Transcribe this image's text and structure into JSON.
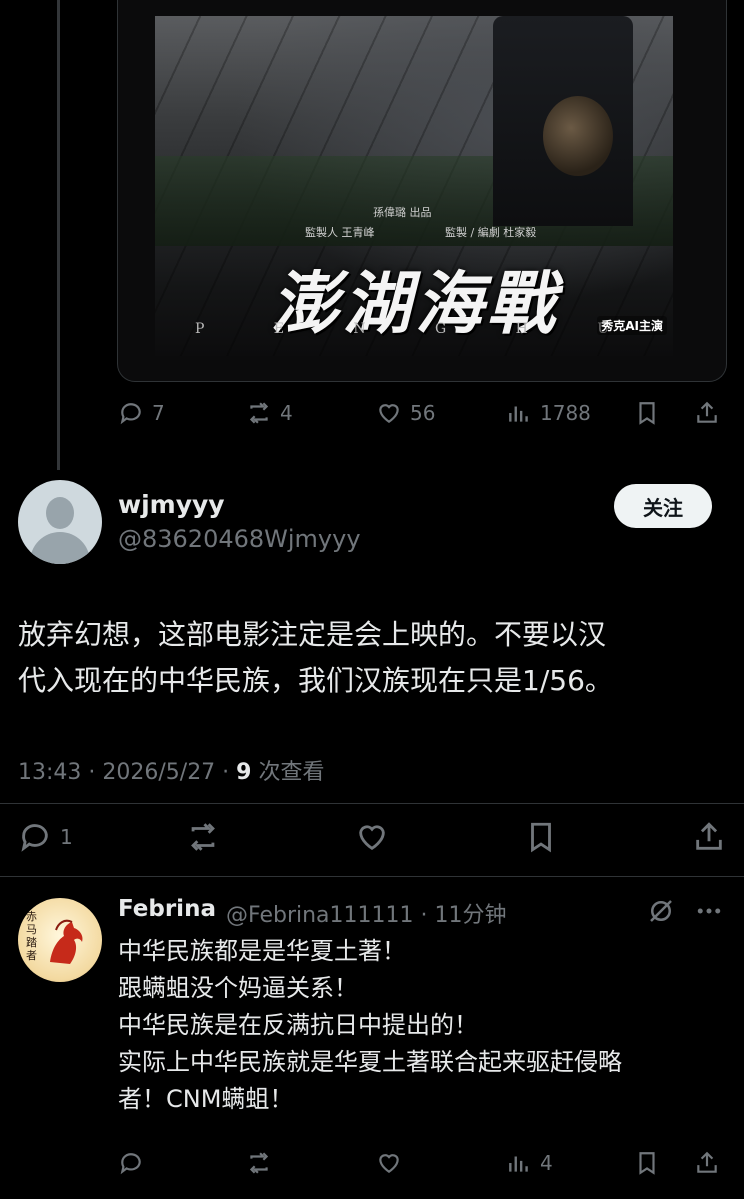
{
  "prev_tweet": {
    "poster": {
      "title_cn": "澎湖海戰",
      "title_en": [
        "P",
        "E",
        "N",
        "G",
        "H",
        "U"
      ],
      "producer": "監製人  王青峰",
      "director": "監製 / 編劇  杜家毅",
      "presenter": "孫偉璐  出品",
      "watermark": "秀克AI主演"
    },
    "actions": {
      "replies": "7",
      "reposts": "4",
      "likes": "56",
      "views": "1788"
    }
  },
  "main_tweet": {
    "display_name": "wjmyyy",
    "handle": "@83620468Wjmyyy",
    "follow_label": "关注",
    "text_lines": [
      "放弃幻想，这部电影注定是会上映的。不要以汉",
      "代入现在的中华民族，我们汉族现在只是1/56。"
    ],
    "time": "13:43 · 2026/5/27 · ",
    "views_count": "9",
    "views_label": " 次查看",
    "actions": {
      "replies": "1"
    }
  },
  "reply": {
    "display_name": "Febrina",
    "handle_time": "@Febrina111111 · 11分钟",
    "avatar_text": "赤马踏者",
    "lines": [
      "中华民族都是是华夏土著！",
      "跟螨蛆没个妈逼关系！",
      "中华民族是在反满抗日中提出的！",
      "实际上中华民族就是华夏土著联合起来驱赶侵略",
      "者！CNM螨蛆！"
    ],
    "actions": {
      "views": "4"
    }
  },
  "colors": {
    "background": "#000000",
    "text": "#e7e9ea",
    "muted": "#71767b",
    "divider": "#2f3336"
  }
}
